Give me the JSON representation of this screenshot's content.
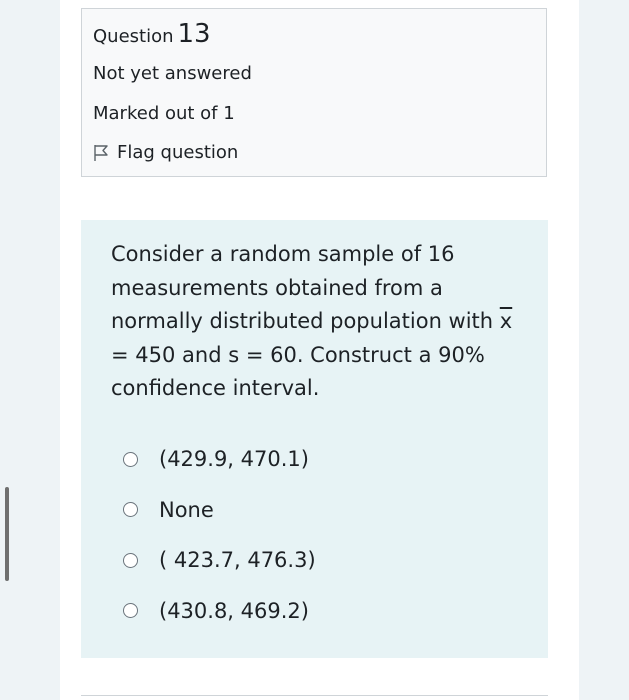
{
  "question": {
    "label": "Question",
    "number": "13",
    "state": "Not yet answered",
    "grade": "Marked out of 1",
    "flag_label": "Flag question"
  },
  "question_text": {
    "part1": "Consider a random sample of 16 measurements obtained from a normally distributed population with ",
    "xbar_symbol": "x",
    "part2": " = 450 and s = 60. Construct a 90% confidence interval."
  },
  "answers": [
    {
      "label": "(429.9, 470.1)"
    },
    {
      "label": "None"
    },
    {
      "label": "( 423.7, 476.3)"
    },
    {
      "label": "(430.8, 469.2)"
    }
  ]
}
